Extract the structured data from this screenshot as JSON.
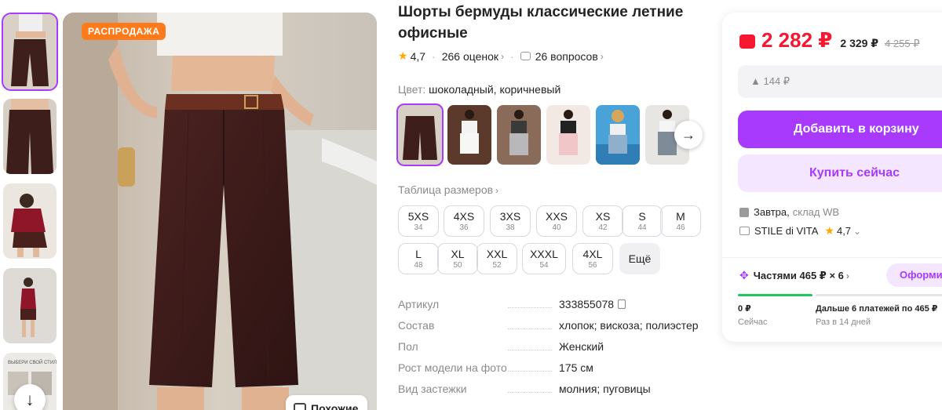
{
  "gallery": {
    "badge": "РАСПРОДАЖА",
    "similar_label": "Похожие",
    "thumb_count": 5
  },
  "product": {
    "title": "Шорты бермуды классические летние офисные",
    "rating": "4,7",
    "reviews": "266 оценок",
    "questions": "26 вопросов"
  },
  "color": {
    "label": "Цвет:",
    "value": "шоколадный, коричневый"
  },
  "size_table_label": "Таблица размеров",
  "sizes": [
    {
      "name": "5XS",
      "ru": "34"
    },
    {
      "name": "4XS",
      "ru": "36"
    },
    {
      "name": "3XS",
      "ru": "38"
    },
    {
      "name": "XXS",
      "ru": "40"
    },
    {
      "name": "XS",
      "ru": "42"
    },
    {
      "name": "S",
      "ru": "44"
    },
    {
      "name": "M",
      "ru": "46"
    },
    {
      "name": "L",
      "ru": "48"
    },
    {
      "name": "XL",
      "ru": "50"
    },
    {
      "name": "XXL",
      "ru": "52"
    },
    {
      "name": "XXXL",
      "ru": "54"
    },
    {
      "name": "4XL",
      "ru": "56"
    }
  ],
  "sizes_more": "Ещё",
  "params": [
    {
      "k": "Артикул",
      "v": "333855078"
    },
    {
      "k": "Состав",
      "v": "хлопок; вискоза; полиэстер"
    },
    {
      "k": "Пол",
      "v": "Женский"
    },
    {
      "k": "Рост модели на фото",
      "v": "175 см"
    },
    {
      "k": "Вид застежки",
      "v": "молния; пуговицы"
    }
  ],
  "buy": {
    "price": "2 282 ₽",
    "price_old1": "2 329 ₽",
    "price_old2": "4 255 ₽",
    "diff": "▲ 144 ₽",
    "add_to_cart": "Добавить в корзину",
    "buy_now": "Купить сейчас",
    "delivery": "Завтра,",
    "delivery_from": "склад WB",
    "seller": "STILE di VITA",
    "seller_rating": "4,7",
    "parts": "Частями 465 ₽ × 6",
    "issue": "Оформи",
    "now_amount": "0 ₽",
    "now_label": "Сейчас",
    "next_amount": "Дальше 6 платежей по 465 ₽",
    "next_label": "Раз в 14 дней"
  },
  "colors": {
    "accent": "#a73afd",
    "price_red": "#f51830",
    "sale_orange": "#ff7a1a",
    "star": "#ffa800",
    "progress_green": "#22c55e"
  }
}
